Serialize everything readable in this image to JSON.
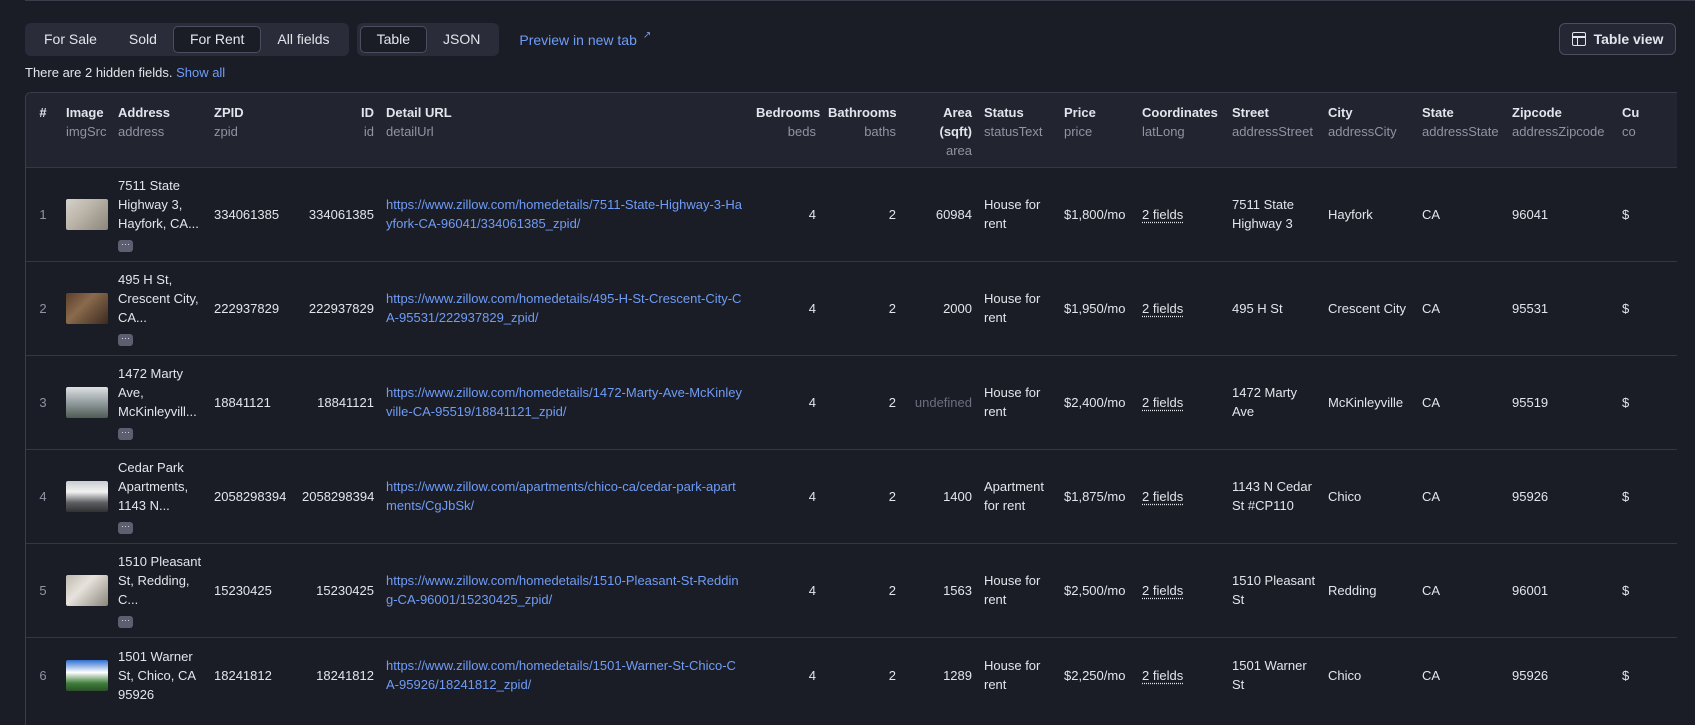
{
  "toolbar": {
    "view_tabs": [
      "For Sale",
      "Sold",
      "For Rent",
      "All fields"
    ],
    "active_view": "For Rent",
    "format_tabs": [
      "Table",
      "JSON"
    ],
    "active_format": "Table",
    "preview_label": "Preview in new tab",
    "table_view_label": "Table view"
  },
  "hidden_fields": {
    "text": "There are 2 hidden fields.",
    "show_all": "Show all"
  },
  "columns": [
    {
      "label": "#",
      "key": ""
    },
    {
      "label": "Image",
      "key": "imgSrc"
    },
    {
      "label": "Address",
      "key": "address"
    },
    {
      "label": "ZPID",
      "key": "zpid"
    },
    {
      "label": "ID",
      "key": "id"
    },
    {
      "label": "Detail URL",
      "key": "detailUrl"
    },
    {
      "label": "Bedrooms",
      "key": "beds"
    },
    {
      "label": "Bathrooms",
      "key": "baths"
    },
    {
      "label": "Area (sqft)",
      "key": "area"
    },
    {
      "label": "Status",
      "key": "statusText"
    },
    {
      "label": "Price",
      "key": "price"
    },
    {
      "label": "Coordinates",
      "key": "latLong"
    },
    {
      "label": "Street",
      "key": "addressStreet"
    },
    {
      "label": "City",
      "key": "addressCity"
    },
    {
      "label": "State",
      "key": "addressState"
    },
    {
      "label": "Zipcode",
      "key": "addressZipcode"
    },
    {
      "label": "Cu",
      "key": "co"
    }
  ],
  "rows": [
    {
      "index": "1",
      "address": "7511 State Highway 3, Hayfork, CA...",
      "zpid": "334061385",
      "id": "334061385",
      "url": "https://www.zillow.com/homedetails/7511-State-Highway-3-Hayfork-CA-96041/334061385_zpid/",
      "beds": "4",
      "baths": "2",
      "area": "60984",
      "status": "House for rent",
      "price": "$1,800/mo",
      "coords": "2 fields",
      "street": "7511 State Highway 3",
      "city": "Hayfork",
      "state": "CA",
      "zip": "96041",
      "cur": "$"
    },
    {
      "index": "2",
      "address": "495 H St, Crescent City, CA...",
      "zpid": "222937829",
      "id": "222937829",
      "url": "https://www.zillow.com/homedetails/495-H-St-Crescent-City-CA-95531/222937829_zpid/",
      "beds": "4",
      "baths": "2",
      "area": "2000",
      "status": "House for rent",
      "price": "$1,950/mo",
      "coords": "2 fields",
      "street": "495 H St",
      "city": "Crescent City",
      "state": "CA",
      "zip": "95531",
      "cur": "$"
    },
    {
      "index": "3",
      "address": "1472 Marty Ave, McKinleyvill...",
      "zpid": "18841121",
      "id": "18841121",
      "url": "https://www.zillow.com/homedetails/1472-Marty-Ave-McKinleyville-CA-95519/18841121_zpid/",
      "beds": "4",
      "baths": "2",
      "area": "undefined",
      "status": "House for rent",
      "price": "$2,400/mo",
      "coords": "2 fields",
      "street": "1472 Marty Ave",
      "city": "McKinleyville",
      "state": "CA",
      "zip": "95519",
      "cur": "$"
    },
    {
      "index": "4",
      "address": "Cedar Park Apartments, 1143 N...",
      "zpid": "2058298394",
      "id": "2058298394",
      "url": "https://www.zillow.com/apartments/chico-ca/cedar-park-apartments/CgJbSk/",
      "beds": "4",
      "baths": "2",
      "area": "1400",
      "status": "Apartment for rent",
      "price": "$1,875/mo",
      "coords": "2 fields",
      "street": "1143 N Cedar St #CP110",
      "city": "Chico",
      "state": "CA",
      "zip": "95926",
      "cur": "$"
    },
    {
      "index": "5",
      "address": "1510 Pleasant St, Redding, C...",
      "zpid": "15230425",
      "id": "15230425",
      "url": "https://www.zillow.com/homedetails/1510-Pleasant-St-Redding-CA-96001/15230425_zpid/",
      "beds": "4",
      "baths": "2",
      "area": "1563",
      "status": "House for rent",
      "price": "$2,500/mo",
      "coords": "2 fields",
      "street": "1510 Pleasant St",
      "city": "Redding",
      "state": "CA",
      "zip": "96001",
      "cur": "$"
    },
    {
      "index": "6",
      "address": "1501 Warner St, Chico, CA 95926",
      "zpid": "18241812",
      "id": "18241812",
      "url": "https://www.zillow.com/homedetails/1501-Warner-St-Chico-CA-95926/18241812_zpid/",
      "beds": "4",
      "baths": "2",
      "area": "1289",
      "status": "House for rent",
      "price": "$2,250/mo",
      "coords": "2 fields",
      "street": "1501 Warner St",
      "city": "Chico",
      "state": "CA",
      "zip": "95926",
      "cur": "$"
    }
  ],
  "more_glyph": "···",
  "ext_glyph": "↗",
  "undefined_color": "#6b6f7f",
  "link_color": "#6f9cf6"
}
